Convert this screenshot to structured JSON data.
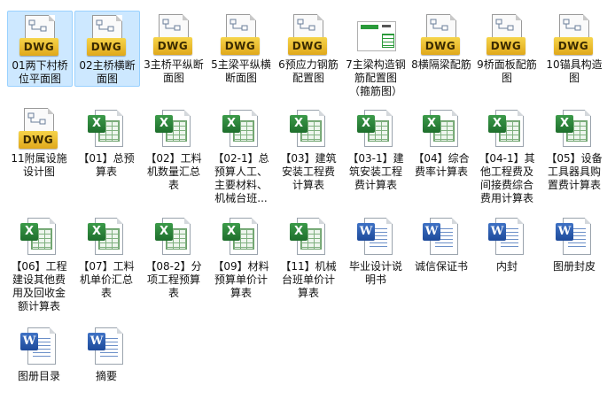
{
  "files": [
    {
      "name": "01两下村桥位平面图",
      "type": "dwg",
      "selected": true
    },
    {
      "name": "02主桥横断面图",
      "type": "dwg",
      "selected": true
    },
    {
      "name": "3主桥平纵断面图",
      "type": "dwg"
    },
    {
      "name": "5主梁平纵横断面图",
      "type": "dwg"
    },
    {
      "name": "6预应力钢筋配置图",
      "type": "dwg"
    },
    {
      "name": "7主梁构造钢筋配置图（箍筋图）",
      "type": "preview"
    },
    {
      "name": "8横隔梁配筋",
      "type": "dwg"
    },
    {
      "name": "9桥面板配筋图",
      "type": "dwg"
    },
    {
      "name": "10锚具构造图",
      "type": "dwg"
    },
    {
      "name": "11附属设施设计图",
      "type": "dwg"
    },
    {
      "name": "【01】总预算表",
      "type": "xls"
    },
    {
      "name": "【02】工料机数量汇总表",
      "type": "xls"
    },
    {
      "name": "【02-1】总预算人工、主要材料、机械台班...",
      "type": "xls"
    },
    {
      "name": "【03】建筑安装工程费计算表",
      "type": "xls"
    },
    {
      "name": "【03-1】建筑安装工程费计算表",
      "type": "xls"
    },
    {
      "name": "【04】综合费率计算表",
      "type": "xls"
    },
    {
      "name": "【04-1】其他工程费及间接费综合费用计算表",
      "type": "xls"
    },
    {
      "name": "【05】设备工具器具购置费计算表",
      "type": "xls"
    },
    {
      "name": "【06】工程建设其他费用及回收金额计算表",
      "type": "xls"
    },
    {
      "name": "【07】工料机单价汇总表",
      "type": "xls"
    },
    {
      "name": "【08-2】分项工程预算表",
      "type": "xls"
    },
    {
      "name": "【09】材料预算单价计算表",
      "type": "xls"
    },
    {
      "name": "【11】机械台班单价计算表",
      "type": "xls"
    },
    {
      "name": "毕业设计说明书",
      "type": "doc"
    },
    {
      "name": "诚信保证书",
      "type": "doc"
    },
    {
      "name": "内封",
      "type": "doc"
    },
    {
      "name": "图册封皮",
      "type": "doc"
    },
    {
      "name": "图册目录",
      "type": "doc"
    },
    {
      "name": "摘要",
      "type": "doc"
    }
  ],
  "labels": {
    "dwg_tag": "DWG",
    "xls_badge": "X",
    "doc_badge": "W"
  }
}
